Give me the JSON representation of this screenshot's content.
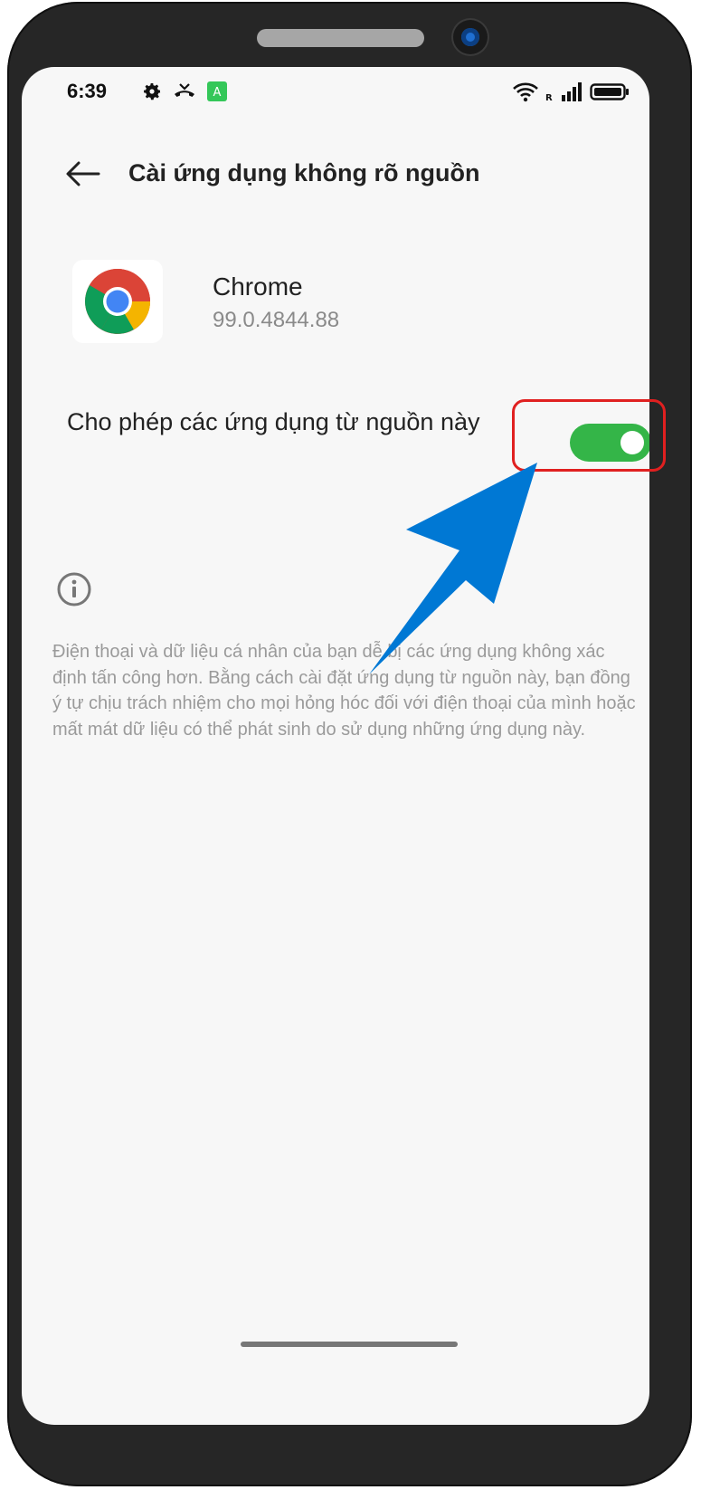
{
  "status_bar": {
    "time": "6:39",
    "left_icons": [
      "settings-icon",
      "call-forward-icon",
      "app-badge-icon"
    ],
    "app_badge_letter": "A",
    "right_icons": [
      "wifi-icon",
      "roaming-icon",
      "signal-icon",
      "battery-icon"
    ],
    "roaming_letter": "R"
  },
  "header": {
    "back_icon": "arrow-left-icon",
    "title": "Cài ứng dụng không rõ nguồn"
  },
  "app": {
    "icon": "chrome-icon",
    "name": "Chrome",
    "version": "99.0.4844.88"
  },
  "setting": {
    "label": "Cho phép các ứng dụng từ nguồn này",
    "enabled": true
  },
  "info": {
    "icon": "info-icon",
    "text": "Điện thoại và dữ liệu cá nhân của bạn dễ bị các ứng dụng không xác định tấn công hơn. Bằng cách cài đặt ứng dụng từ nguồn này, bạn đồng ý tự chịu trách nhiệm cho mọi hỏng hóc đối với điện thoại của mình hoặc mất mát dữ liệu có thể phát sinh do sử dụng những ứng dụng này."
  },
  "colors": {
    "toggle_on": "#34b548",
    "highlight": "#e02020",
    "arrow": "#0078d4",
    "screen_bg": "#f7f7f7",
    "frame": "#262626"
  }
}
